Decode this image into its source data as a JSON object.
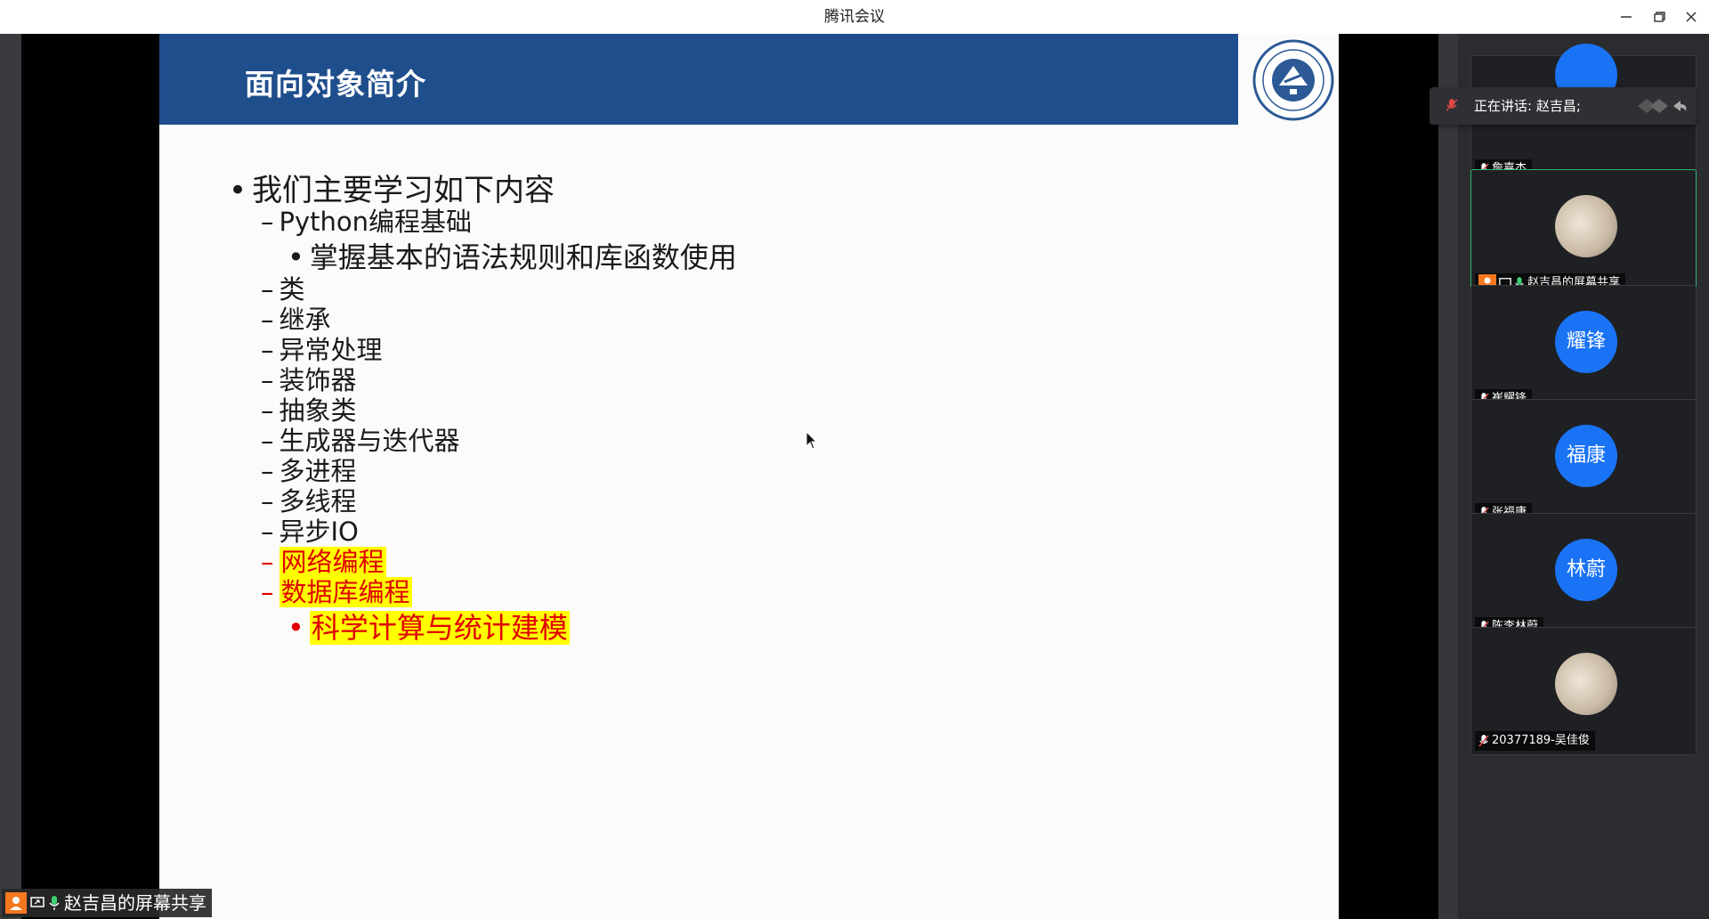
{
  "window": {
    "title": "腾讯会议"
  },
  "slide": {
    "title": "面向对象简介",
    "lines": [
      {
        "level": 1,
        "bullet": "•",
        "text": "我们主要学习如下内容",
        "highlight": false
      },
      {
        "level": 2,
        "bullet": "–",
        "text": "Python编程基础",
        "highlight": false
      },
      {
        "level": 3,
        "bullet": "•",
        "text": "掌握基本的语法规则和库函数使用",
        "highlight": false
      },
      {
        "level": 2,
        "bullet": "–",
        "text": "类",
        "highlight": false
      },
      {
        "level": 2,
        "bullet": "–",
        "text": "继承",
        "highlight": false
      },
      {
        "level": 2,
        "bullet": "–",
        "text": "异常处理",
        "highlight": false
      },
      {
        "level": 2,
        "bullet": "–",
        "text": "装饰器",
        "highlight": false
      },
      {
        "level": 2,
        "bullet": "–",
        "text": "抽象类",
        "highlight": false
      },
      {
        "level": 2,
        "bullet": "–",
        "text": "生成器与迭代器",
        "highlight": false
      },
      {
        "level": 2,
        "bullet": "–",
        "text": "多进程",
        "highlight": false
      },
      {
        "level": 2,
        "bullet": "–",
        "text": "多线程",
        "highlight": false
      },
      {
        "level": 2,
        "bullet": "–",
        "text": "异步IO",
        "highlight": false
      },
      {
        "level": 2,
        "bullet": "–",
        "text": "网络编程",
        "highlight": true
      },
      {
        "level": 2,
        "bullet": "–",
        "text": "数据库编程",
        "highlight": true
      },
      {
        "level": 3,
        "bullet": "•",
        "text": "科学计算与统计建模",
        "highlight": true
      }
    ]
  },
  "speaking_banner": {
    "text": "正在讲话: 赵吉昌;"
  },
  "participants": [
    {
      "name": "詹嘉杰",
      "avatar_text": "",
      "avatar_type": "color"
    },
    {
      "name": "赵吉昌的屏幕共享",
      "avatar_text": "",
      "avatar_type": "photo"
    },
    {
      "name": "崔耀锋",
      "avatar_text": "耀锋",
      "avatar_type": "color"
    },
    {
      "name": "张福康",
      "avatar_text": "福康",
      "avatar_type": "color"
    },
    {
      "name": "陈李林蔚",
      "avatar_text": "林蔚",
      "avatar_type": "color"
    },
    {
      "name": "20377189-吴佳俊",
      "avatar_text": "",
      "avatar_type": "photo"
    }
  ],
  "share_tag": {
    "text": "赵吉昌的屏幕共享"
  },
  "colors": {
    "header_blue": "#1f4e8c",
    "avatar_blue": "#1a73f5",
    "highlight_yellow": "#ffff00",
    "highlight_red": "#e00000",
    "active_green": "#2fb36f"
  }
}
